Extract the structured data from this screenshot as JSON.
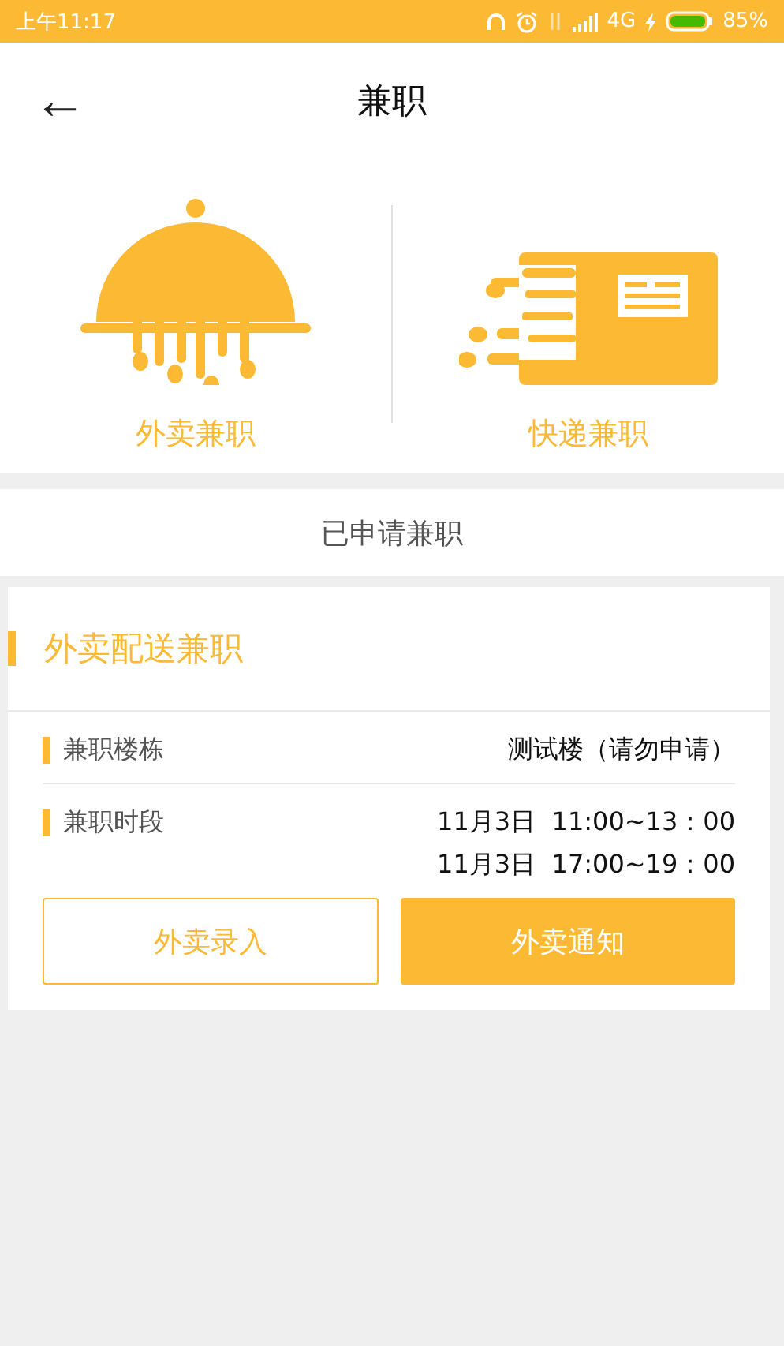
{
  "status_bar": {
    "time": "上午11:17",
    "network": "4G",
    "battery": "85%"
  },
  "header": {
    "back_icon": "←",
    "title": "兼职"
  },
  "categories": [
    {
      "kind": "takeout",
      "label": "外卖兼职"
    },
    {
      "kind": "courier",
      "label": "快递兼职"
    }
  ],
  "section_title": "已申请兼职",
  "card": {
    "title": "外卖配送兼职",
    "rows": [
      {
        "label": "兼职楼栋",
        "values": [
          "测试楼（请勿申请）"
        ]
      },
      {
        "label": "兼职时段",
        "values": [
          "11月3日  11:00~13：00",
          "11月3日  17:00~19：00"
        ]
      }
    ],
    "buttons": [
      {
        "kind": "outline",
        "label": "外卖录入"
      },
      {
        "kind": "filled",
        "label": "外卖通知"
      }
    ]
  }
}
